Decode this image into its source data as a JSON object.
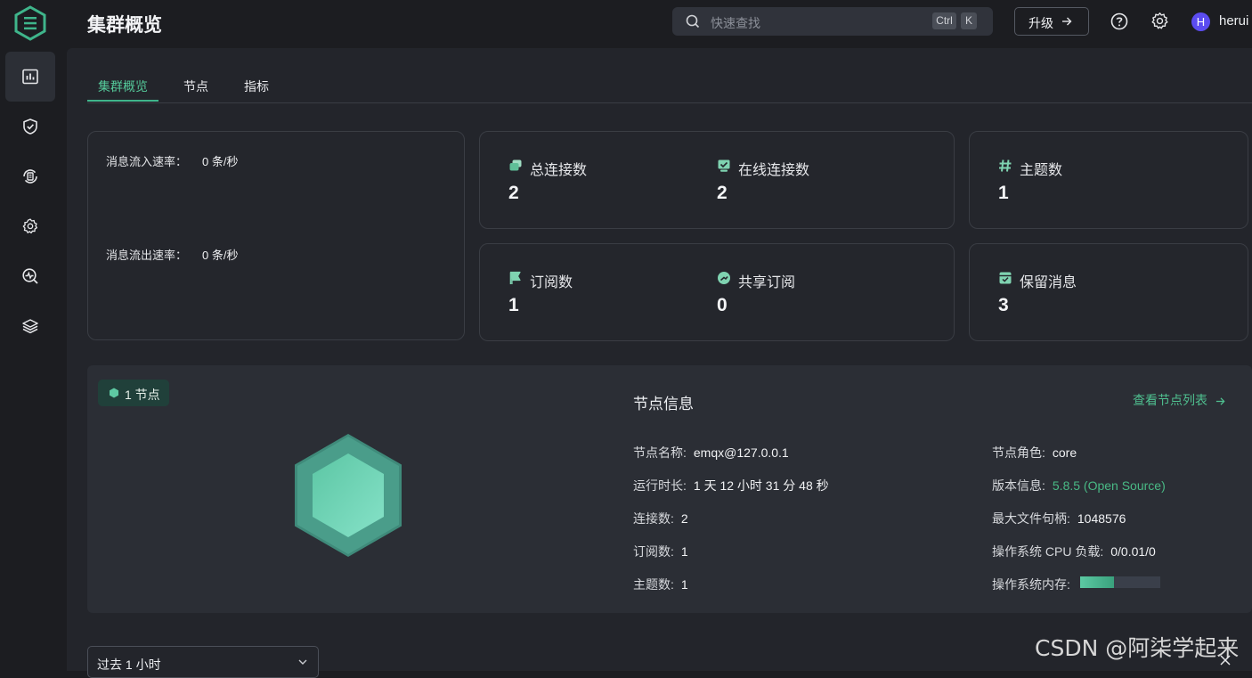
{
  "app": {
    "title": "集群概览",
    "brand_color": "#3fb58b"
  },
  "header": {
    "search_placeholder": "快速查找",
    "shortcut_key1": "Ctrl",
    "shortcut_key2": "K",
    "upgrade_label": "升级",
    "user_initial": "H",
    "username": "herui",
    "icons": [
      "search-icon",
      "arrow-right-icon",
      "help-icon",
      "gear-icon"
    ]
  },
  "sidebar": {
    "items": [
      {
        "icon": "dashboard-icon",
        "active": true
      },
      {
        "icon": "shield-icon",
        "active": false
      },
      {
        "icon": "data-flow-icon",
        "active": false
      },
      {
        "icon": "settings-icon",
        "active": false
      },
      {
        "icon": "diagnose-icon",
        "active": false
      },
      {
        "icon": "extensions-icon",
        "active": false
      }
    ]
  },
  "tabs": [
    {
      "label": "集群概览",
      "active": true
    },
    {
      "label": "节点",
      "active": false
    },
    {
      "label": "指标",
      "active": false
    }
  ],
  "rates": {
    "in_label": "消息流入速率：",
    "in_value": "0 条/秒",
    "out_label": "消息流出速率：",
    "out_value": "0 条/秒"
  },
  "stats": {
    "connections": {
      "label": "总连接数",
      "value": "2"
    },
    "online": {
      "label": "在线连接数",
      "value": "2"
    },
    "topics": {
      "label": "主题数",
      "value": "1"
    },
    "subscriptions": {
      "label": "订阅数",
      "value": "1"
    },
    "shared": {
      "label": "共享订阅",
      "value": "0"
    },
    "retained": {
      "label": "保留消息",
      "value": "3"
    }
  },
  "node_panel": {
    "badge": "1 节点",
    "title": "节点信息",
    "link": "查看节点列表",
    "left_rows": [
      {
        "key": "节点名称:",
        "value": "emqx@127.0.0.1"
      },
      {
        "key": "运行时长:",
        "value": "1 天 12 小时 31 分 48 秒"
      },
      {
        "key": "连接数:",
        "value": "2"
      },
      {
        "key": "订阅数:",
        "value": "1"
      },
      {
        "key": "主题数:",
        "value": "1"
      }
    ],
    "right_rows": [
      {
        "key": "节点角色:",
        "value": "core"
      },
      {
        "key": "版本信息:",
        "value": "5.8.5 (Open Source)"
      },
      {
        "key": "最大文件句柄:",
        "value": "1048576"
      },
      {
        "key": "操作系统 CPU 负载:",
        "value": "0/0.01/0"
      }
    ],
    "memory_label": "操作系统内存:",
    "memory_fraction": 0.42
  },
  "range": {
    "selected": "过去 1 小时"
  },
  "watermark": "CSDN @阿柒学起来"
}
